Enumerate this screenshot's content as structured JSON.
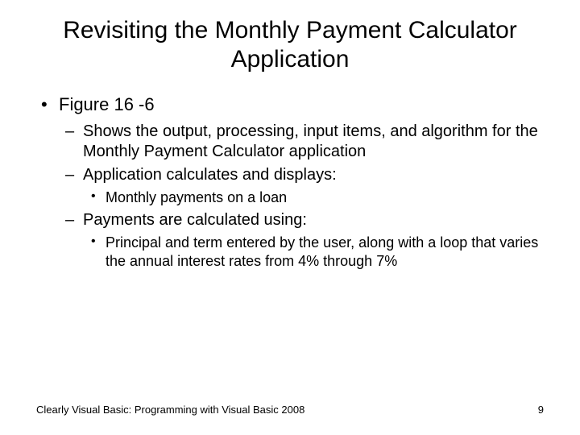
{
  "title": "Revisiting the Monthly Payment Calculator Application",
  "bullets": {
    "l1_0": "Figure 16 -6",
    "l2_0": "Shows the output, processing, input items, and algorithm for the Monthly Payment Calculator application",
    "l2_1": "Application calculates and displays:",
    "l3_0": "Monthly payments on a loan",
    "l2_2": "Payments are calculated using:",
    "l3_1": "Principal and term entered by the user, along with a loop that varies the annual interest rates from 4% through 7%"
  },
  "footer": {
    "source": "Clearly Visual Basic: Programming with Visual Basic 2008",
    "page": "9"
  }
}
